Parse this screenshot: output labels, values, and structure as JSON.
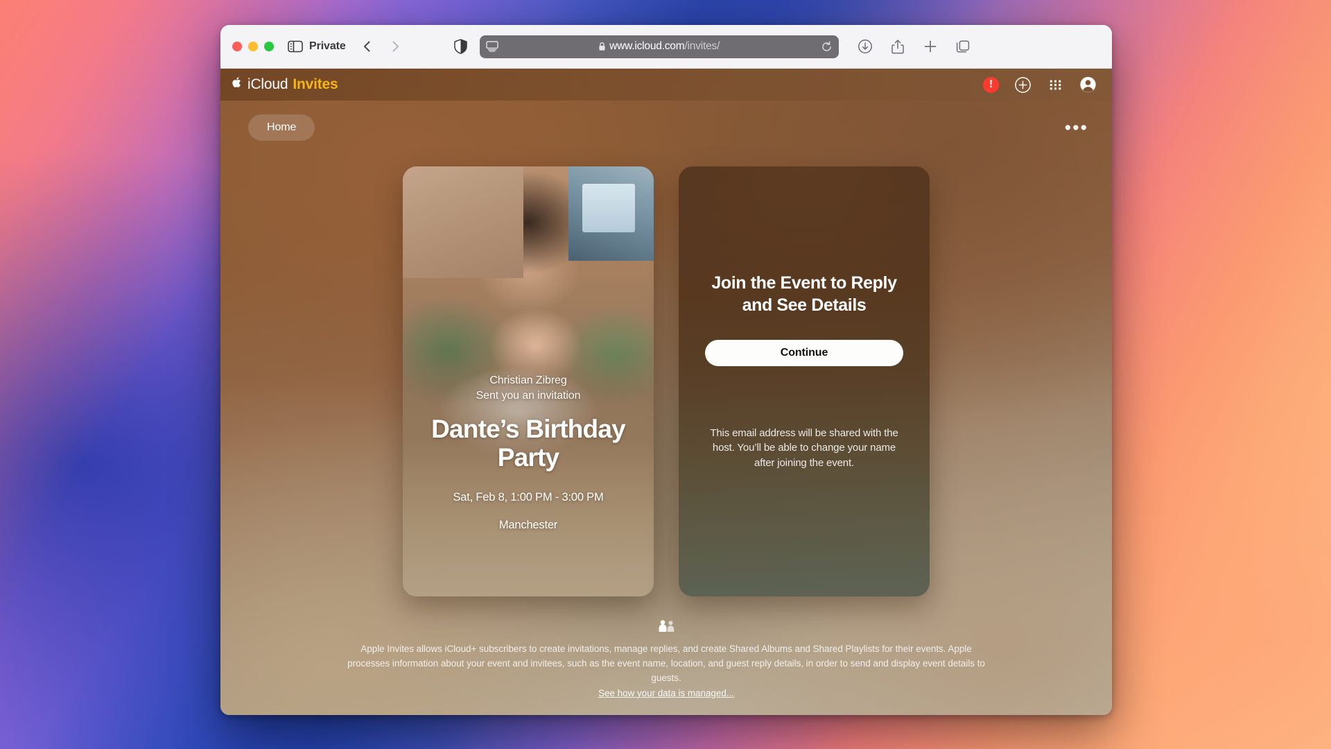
{
  "browser": {
    "window_controls": [
      "close",
      "minimize",
      "maximize"
    ],
    "sidebar_icon": "sidebar-icon",
    "private_label": "Private",
    "back_icon": "chevron-left-icon",
    "forward_icon": "chevron-right-icon",
    "shield_icon": "privacy-shield-icon",
    "reader_icon": "reader-view-icon",
    "lock_icon": "lock-icon",
    "url_domain": "www.icloud.com",
    "url_path": "/invites/",
    "reload_icon": "reload-icon",
    "downloads_icon": "downloads-icon",
    "share_icon": "share-icon",
    "new_tab_icon": "plus-icon",
    "tab_overview_icon": "tab-overview-icon"
  },
  "app_header": {
    "apple_glyph": "",
    "brand_primary": "iCloud",
    "brand_secondary": "Invites",
    "brand_secondary_color": "#f5b517",
    "alert_badge": "!",
    "alert_color": "#ff3b30",
    "add_icon": "plus-circle-icon",
    "apps_icon": "app-grid-icon",
    "account_icon": "account-avatar-icon"
  },
  "nav": {
    "home_label": "Home",
    "more_label": "•••"
  },
  "invite": {
    "host_name": "Christian Zibreg",
    "host_subtitle": "Sent you an invitation",
    "event_title": "Dante’s Birthday Party",
    "event_when": "Sat, Feb 8, 1:00 PM - 3:00 PM",
    "event_where": "Manchester"
  },
  "join_panel": {
    "title": "Join the Event to Reply and See Details",
    "continue_label": "Continue",
    "note": "This email address will be shared with the host. You’ll be able to change your name after joining the event."
  },
  "footer": {
    "people_icon": "two-people-icon",
    "text": "Apple Invites allows iCloud+ subscribers to create invitations, manage replies, and create Shared Albums and Shared Playlists for their events. Apple processes information about your event and invitees, such as the event name, location, and guest reply details, in order to send and display event details to guests.",
    "link_label": "See how your data is managed..."
  }
}
